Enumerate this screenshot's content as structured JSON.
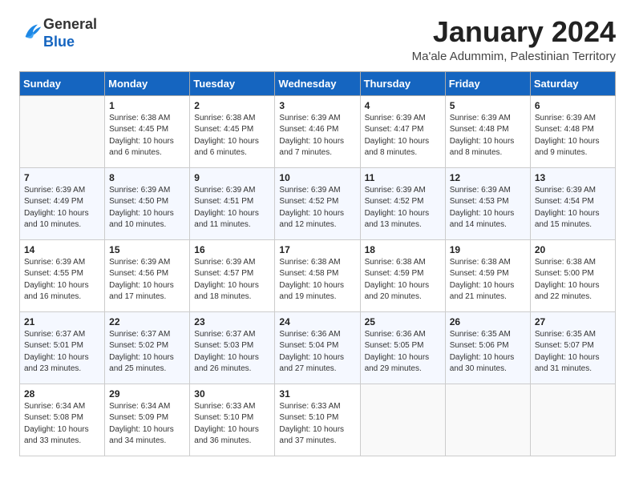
{
  "header": {
    "logo": {
      "general": "General",
      "blue": "Blue"
    },
    "title": "January 2024",
    "location": "Ma'ale Adummim, Palestinian Territory"
  },
  "weekdays": [
    "Sunday",
    "Monday",
    "Tuesday",
    "Wednesday",
    "Thursday",
    "Friday",
    "Saturday"
  ],
  "weeks": [
    [
      {
        "day": null
      },
      {
        "day": "1",
        "sunrise": "6:38 AM",
        "sunset": "4:45 PM",
        "daylight": "10 hours and 6 minutes."
      },
      {
        "day": "2",
        "sunrise": "6:38 AM",
        "sunset": "4:45 PM",
        "daylight": "10 hours and 6 minutes."
      },
      {
        "day": "3",
        "sunrise": "6:39 AM",
        "sunset": "4:46 PM",
        "daylight": "10 hours and 7 minutes."
      },
      {
        "day": "4",
        "sunrise": "6:39 AM",
        "sunset": "4:47 PM",
        "daylight": "10 hours and 8 minutes."
      },
      {
        "day": "5",
        "sunrise": "6:39 AM",
        "sunset": "4:48 PM",
        "daylight": "10 hours and 8 minutes."
      },
      {
        "day": "6",
        "sunrise": "6:39 AM",
        "sunset": "4:48 PM",
        "daylight": "10 hours and 9 minutes."
      }
    ],
    [
      {
        "day": "7",
        "sunrise": "6:39 AM",
        "sunset": "4:49 PM",
        "daylight": "10 hours and 10 minutes."
      },
      {
        "day": "8",
        "sunrise": "6:39 AM",
        "sunset": "4:50 PM",
        "daylight": "10 hours and 10 minutes."
      },
      {
        "day": "9",
        "sunrise": "6:39 AM",
        "sunset": "4:51 PM",
        "daylight": "10 hours and 11 minutes."
      },
      {
        "day": "10",
        "sunrise": "6:39 AM",
        "sunset": "4:52 PM",
        "daylight": "10 hours and 12 minutes."
      },
      {
        "day": "11",
        "sunrise": "6:39 AM",
        "sunset": "4:52 PM",
        "daylight": "10 hours and 13 minutes."
      },
      {
        "day": "12",
        "sunrise": "6:39 AM",
        "sunset": "4:53 PM",
        "daylight": "10 hours and 14 minutes."
      },
      {
        "day": "13",
        "sunrise": "6:39 AM",
        "sunset": "4:54 PM",
        "daylight": "10 hours and 15 minutes."
      }
    ],
    [
      {
        "day": "14",
        "sunrise": "6:39 AM",
        "sunset": "4:55 PM",
        "daylight": "10 hours and 16 minutes."
      },
      {
        "day": "15",
        "sunrise": "6:39 AM",
        "sunset": "4:56 PM",
        "daylight": "10 hours and 17 minutes."
      },
      {
        "day": "16",
        "sunrise": "6:39 AM",
        "sunset": "4:57 PM",
        "daylight": "10 hours and 18 minutes."
      },
      {
        "day": "17",
        "sunrise": "6:38 AM",
        "sunset": "4:58 PM",
        "daylight": "10 hours and 19 minutes."
      },
      {
        "day": "18",
        "sunrise": "6:38 AM",
        "sunset": "4:59 PM",
        "daylight": "10 hours and 20 minutes."
      },
      {
        "day": "19",
        "sunrise": "6:38 AM",
        "sunset": "4:59 PM",
        "daylight": "10 hours and 21 minutes."
      },
      {
        "day": "20",
        "sunrise": "6:38 AM",
        "sunset": "5:00 PM",
        "daylight": "10 hours and 22 minutes."
      }
    ],
    [
      {
        "day": "21",
        "sunrise": "6:37 AM",
        "sunset": "5:01 PM",
        "daylight": "10 hours and 23 minutes."
      },
      {
        "day": "22",
        "sunrise": "6:37 AM",
        "sunset": "5:02 PM",
        "daylight": "10 hours and 25 minutes."
      },
      {
        "day": "23",
        "sunrise": "6:37 AM",
        "sunset": "5:03 PM",
        "daylight": "10 hours and 26 minutes."
      },
      {
        "day": "24",
        "sunrise": "6:36 AM",
        "sunset": "5:04 PM",
        "daylight": "10 hours and 27 minutes."
      },
      {
        "day": "25",
        "sunrise": "6:36 AM",
        "sunset": "5:05 PM",
        "daylight": "10 hours and 29 minutes."
      },
      {
        "day": "26",
        "sunrise": "6:35 AM",
        "sunset": "5:06 PM",
        "daylight": "10 hours and 30 minutes."
      },
      {
        "day": "27",
        "sunrise": "6:35 AM",
        "sunset": "5:07 PM",
        "daylight": "10 hours and 31 minutes."
      }
    ],
    [
      {
        "day": "28",
        "sunrise": "6:34 AM",
        "sunset": "5:08 PM",
        "daylight": "10 hours and 33 minutes."
      },
      {
        "day": "29",
        "sunrise": "6:34 AM",
        "sunset": "5:09 PM",
        "daylight": "10 hours and 34 minutes."
      },
      {
        "day": "30",
        "sunrise": "6:33 AM",
        "sunset": "5:10 PM",
        "daylight": "10 hours and 36 minutes."
      },
      {
        "day": "31",
        "sunrise": "6:33 AM",
        "sunset": "5:10 PM",
        "daylight": "10 hours and 37 minutes."
      },
      {
        "day": null
      },
      {
        "day": null
      },
      {
        "day": null
      }
    ]
  ]
}
